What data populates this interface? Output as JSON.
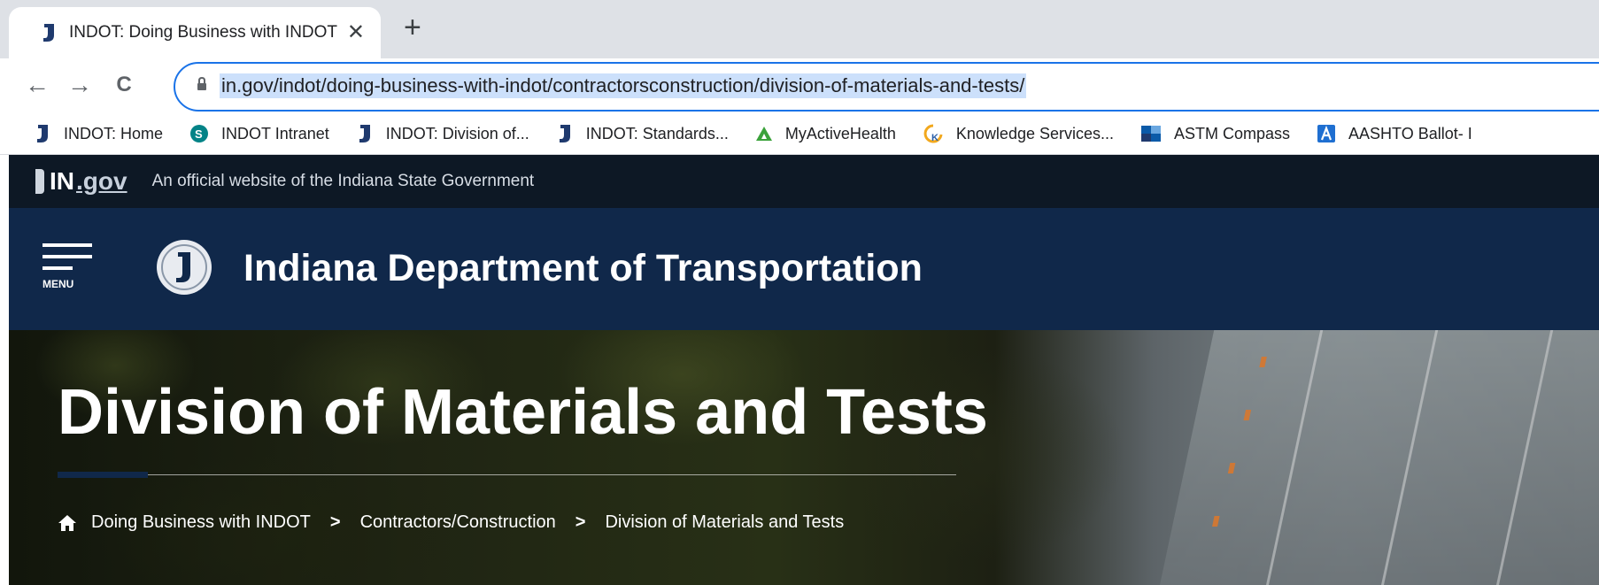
{
  "browser": {
    "tab": {
      "title": "INDOT: Doing Business with INDOT",
      "close_icon": "close-icon"
    },
    "new_tab_label": "+",
    "nav": {
      "back": "←",
      "forward": "→",
      "reload": "C"
    },
    "address_bar": {
      "url": "in.gov/indot/doing-business-with-indot/contractorsconstruction/division-of-materials-and-tests/"
    },
    "bookmarks": [
      {
        "label": "INDOT: Home",
        "icon": "indiana-icon",
        "color": "#1f3a6e"
      },
      {
        "label": "INDOT Intranet",
        "icon": "sharepoint-icon",
        "color": "#038387"
      },
      {
        "label": "INDOT: Division of...",
        "icon": "indiana-icon",
        "color": "#1f3a6e"
      },
      {
        "label": "INDOT: Standards...",
        "icon": "indiana-icon",
        "color": "#1f3a6e"
      },
      {
        "label": "MyActiveHealth",
        "icon": "triangle-icon",
        "color": "#3aa23a"
      },
      {
        "label": "Knowledge Services...",
        "icon": "knowledge-icon",
        "color": "#f2a81d"
      },
      {
        "label": "ASTM Compass",
        "icon": "astm-icon",
        "color": "#0b5aa8"
      },
      {
        "label": "AASHTO Ballot- I",
        "icon": "aashto-icon",
        "color": "#1f6fd1"
      }
    ]
  },
  "gov_banner": {
    "logo_in": "IN",
    "logo_gov": ".gov",
    "text": "An official website of the Indiana State Government"
  },
  "header": {
    "menu_label": "MENU",
    "agency_name": "Indiana Department of Transportation"
  },
  "hero": {
    "title": "Division of Materials and Tests",
    "breadcrumbs": [
      "Doing Business with INDOT",
      "Contractors/Construction",
      "Division of Materials and Tests"
    ],
    "separator": ">"
  },
  "colors": {
    "header_bg": "#10284a",
    "gov_bar_bg": "#0d1825",
    "omnibox_border": "#1a73e8",
    "url_highlight": "#cce0fb"
  }
}
